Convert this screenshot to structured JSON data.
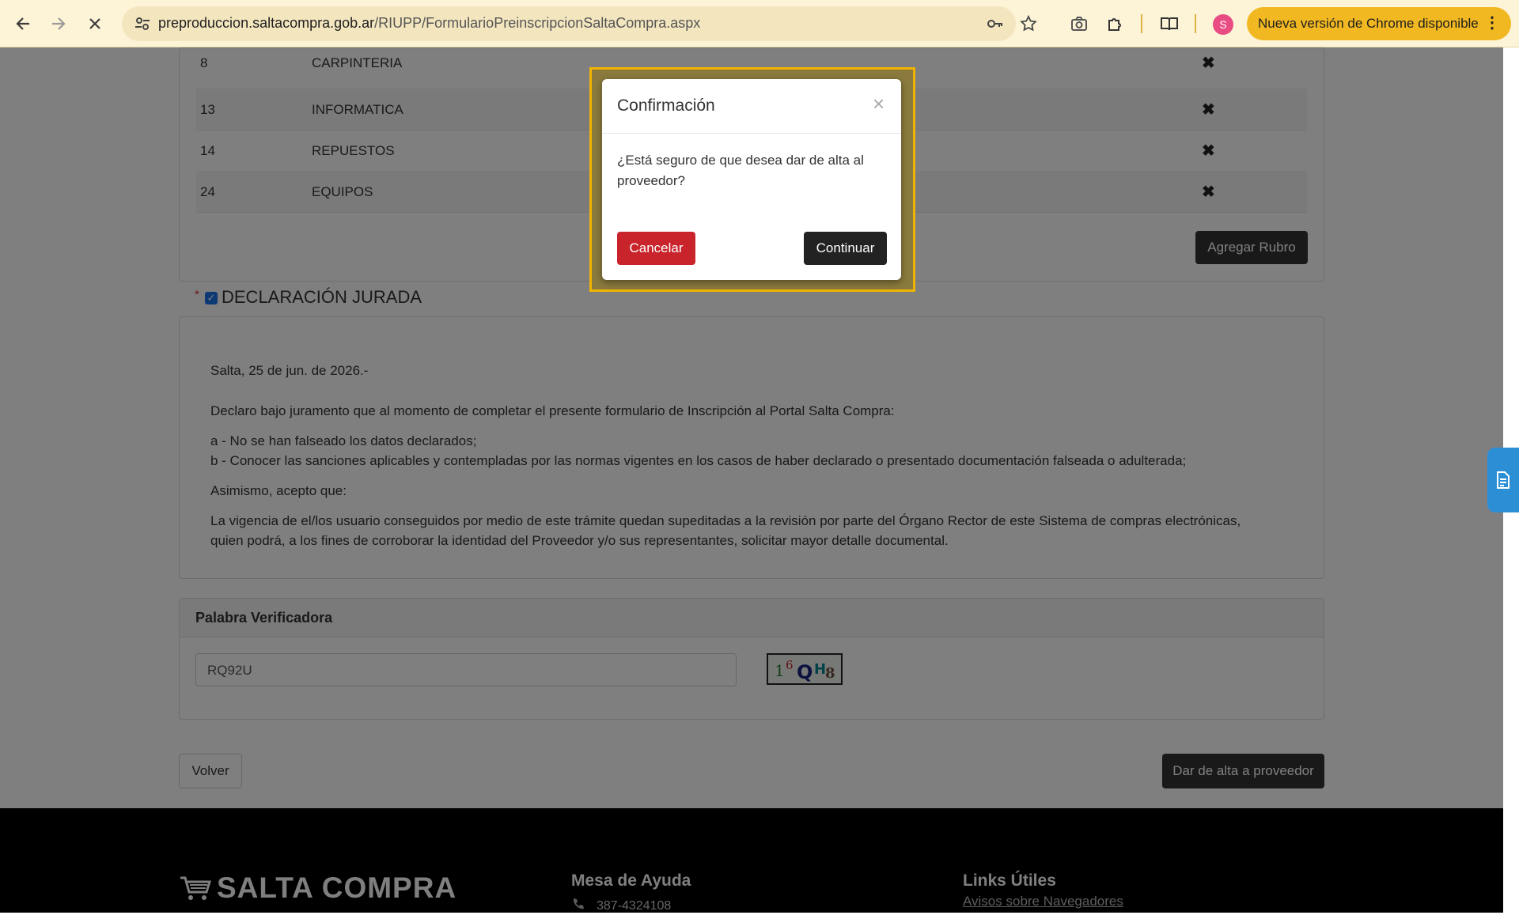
{
  "browser": {
    "url_host": "preproduccion.saltacompra.gob.ar",
    "url_path": "/RIUPP/FormularioPreinscripcionSaltaCompra.aspx",
    "avatar_letter": "S",
    "update_label": "Nueva versión de Chrome disponible",
    "menu_glyph": "⋮",
    "icons": [
      "back-icon",
      "forward-icon",
      "stop-icon",
      "site-settings-icon",
      "password-key-icon",
      "bookmark-star-icon",
      "screenshot-icon",
      "extensions-icon",
      "reading-mode-icon"
    ]
  },
  "rubros": {
    "rows": [
      {
        "code": "8",
        "name": "CARPINTERIA"
      },
      {
        "code": "13",
        "name": "INFORMATICA"
      },
      {
        "code": "14",
        "name": "REPUESTOS"
      },
      {
        "code": "24",
        "name": "EQUIPOS"
      }
    ],
    "delete_glyph": "✖",
    "add_button": "Agregar Rubro"
  },
  "declaracion": {
    "required_mark": "*",
    "check_glyph": "✓",
    "checked": true,
    "title": "DECLARACIÓN JURADA",
    "date": "Salta, 25 de jun. de 2026.-",
    "intro": "Declaro bajo juramento que al momento de completar el presente formulario de Inscripción al Portal Salta Compra:",
    "item_a": "a - No se han falseado los datos declarados;",
    "item_b": "b - Conocer las sanciones aplicables y contempladas por las normas vigentes en los casos de haber declarado o presentado documentación falseada o adulterada;",
    "asimismo": "Asimismo, acepto que:",
    "vigencia_line1": "La vigencia de el/los usuario conseguidos por medio de este trámite quedan supeditadas a la revisión por parte del Órgano Rector de este Sistema de compras electrónicas,",
    "vigencia_line2": "quien podrá, a los fines de corroborar la identidad del Proveedor y/o sus representantes, solicitar mayor detalle documental."
  },
  "verificadora": {
    "title": "Palabra Verificadora",
    "input_value": "RQ92U",
    "captcha_text": "16QH8"
  },
  "actions": {
    "back": "Volver",
    "submit": "Dar de alta a proveedor"
  },
  "footer": {
    "logo": "SALTA COMPRA",
    "help_title": "Mesa de Ayuda",
    "help_phone": "387-4324108",
    "links_title": "Links Útiles",
    "link_browsers": "Avisos sobre Navegadores"
  },
  "modal": {
    "title": "Confirmación",
    "close_glyph": "×",
    "message": "¿Está seguro de que desea dar de alta al proveedor?",
    "cancel": "Cancelar",
    "continue": "Continuar"
  }
}
